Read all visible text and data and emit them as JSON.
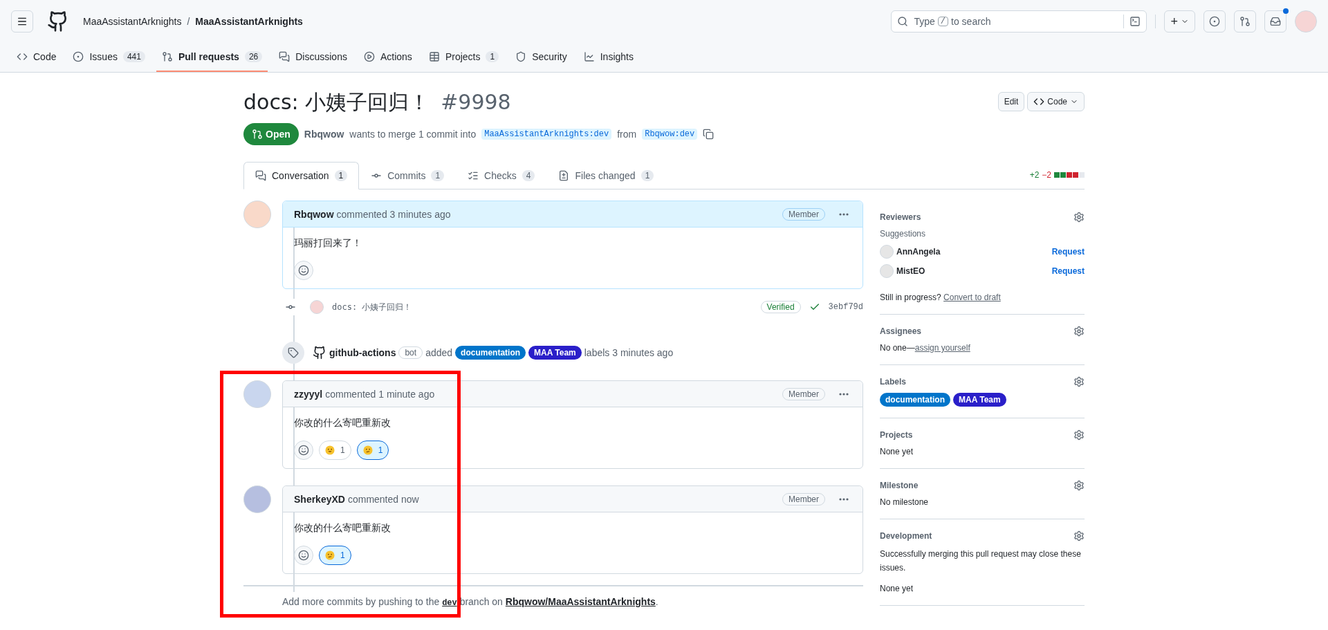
{
  "header": {
    "owner": "MaaAssistantArknights",
    "separator": "/",
    "repo": "MaaAssistantArknights",
    "search": {
      "placeholder_parts": [
        "Type",
        "/",
        "to search"
      ]
    },
    "new_button": "+",
    "inbox": {
      "unread": true
    }
  },
  "repo_nav": [
    {
      "label": "Code",
      "selected": false
    },
    {
      "label": "Issues",
      "count": "441",
      "selected": false
    },
    {
      "label": "Pull requests",
      "count": "26",
      "selected": true
    },
    {
      "label": "Discussions",
      "selected": false
    },
    {
      "label": "Actions",
      "selected": false
    },
    {
      "label": "Projects",
      "count": "1",
      "selected": false
    },
    {
      "label": "Security",
      "selected": false
    },
    {
      "label": "Insights",
      "selected": false
    }
  ],
  "pr": {
    "title": "docs: 小姨子回归！",
    "number": "#9998",
    "edit_button": "Edit",
    "code_button": "Code",
    "state": "Open",
    "author": "Rbqwow",
    "merge_text": "wants to merge 1 commit into",
    "base": "MaaAssistantArknights:dev",
    "from_text": "from",
    "head": "Rbqwow:dev"
  },
  "pr_tabs": [
    {
      "label": "Conversation",
      "count": "1",
      "selected": true
    },
    {
      "label": "Commits",
      "count": "1",
      "selected": false
    },
    {
      "label": "Checks",
      "count": "4",
      "selected": false
    },
    {
      "label": "Files changed",
      "count": "1",
      "selected": false
    }
  ],
  "diffstat": {
    "added": "+2",
    "deleted": "−2"
  },
  "timeline": [
    {
      "kind": "comment",
      "author": "Rbqwow",
      "action": "commented 3 minutes ago",
      "role": "Member",
      "highlighted": true,
      "body": "玛丽打回来了！"
    },
    {
      "kind": "commit",
      "message": "docs: 小姨子回归！",
      "verified": "Verified",
      "sha": "3ebf79d"
    },
    {
      "kind": "labeled",
      "actor": "github-actions",
      "actor_badge": "bot",
      "action": "added",
      "labels": [
        {
          "name": "documentation",
          "color": "#0075ca"
        },
        {
          "name": "MAA Team",
          "color": "#2a1fc9"
        }
      ],
      "suffix": "labels 3 minutes ago"
    },
    {
      "kind": "comment",
      "author": "zzyyyl",
      "action": "commented 1 minute ago",
      "role": "Member",
      "highlighted": false,
      "body": "你改的什么寄吧重新改",
      "reactions": [
        {
          "kind": "grin",
          "count": "1",
          "selected": false
        },
        {
          "kind": "confused",
          "count": "1",
          "selected": true
        }
      ]
    },
    {
      "kind": "comment",
      "author": "SherkeyXD",
      "action": "commented now",
      "role": "Member",
      "highlighted": false,
      "body": "你改的什么寄吧重新改",
      "reactions": [
        {
          "kind": "confused",
          "count": "1",
          "selected": true
        }
      ]
    }
  ],
  "footer": {
    "parts": [
      "Add more commits by pushing to the",
      "dev",
      "branch on",
      "Rbqwow/MaaAssistantArknights",
      "."
    ]
  },
  "sidebar": [
    {
      "kind": "reviewers",
      "title": "Reviewers",
      "subtitle": "Suggestions",
      "people": [
        {
          "name": "AnnAngela",
          "action": "Request"
        },
        {
          "name": "MistEO",
          "action": "Request"
        }
      ],
      "note": "Still in progress?",
      "link": "Convert to draft"
    },
    {
      "kind": "assignees",
      "title": "Assignees",
      "text": "No one—",
      "link": "assign yourself"
    },
    {
      "kind": "labels",
      "title": "Labels",
      "labels": [
        {
          "name": "documentation",
          "color": "#0075ca"
        },
        {
          "name": "MAA Team",
          "color": "#2a1fc9"
        }
      ]
    },
    {
      "kind": "text",
      "title": "Projects",
      "text": "None yet"
    },
    {
      "kind": "text",
      "title": "Milestone",
      "text": "No milestone"
    },
    {
      "kind": "development",
      "title": "Development",
      "text": "Successfully merging this pull request may close these issues.",
      "text2": "None yet"
    }
  ]
}
